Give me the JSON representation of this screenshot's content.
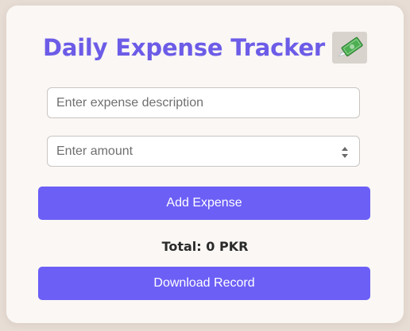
{
  "header": {
    "title": "Daily Expense Tracker",
    "icon": "money-with-wings-icon"
  },
  "form": {
    "description_placeholder": "Enter expense description",
    "description_value": "",
    "amount_placeholder": "Enter amount",
    "amount_value": ""
  },
  "actions": {
    "add_label": "Add Expense",
    "download_label": "Download Record"
  },
  "summary": {
    "total_text": "Total: 0 PKR"
  },
  "colors": {
    "accent": "#6c5ce7",
    "button": "#6c5ff6",
    "background": "#e7ddd5",
    "card": "#faf7f4"
  }
}
